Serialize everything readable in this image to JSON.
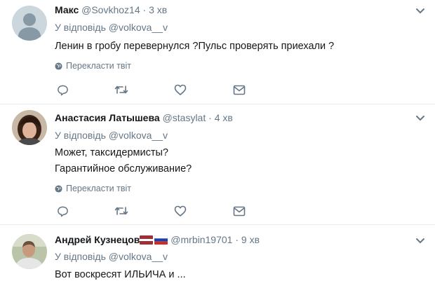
{
  "colors": {
    "text": "#14171a",
    "secondary": "#657786",
    "divider": "#e6ecf0"
  },
  "tweets": [
    {
      "name": "Макс",
      "handle": "@Sovkhoz14",
      "time": "3 хв",
      "reply_prefix": "У відповідь",
      "reply_to": "@volkova__v",
      "lines": [
        "Ленин в гробу перевернулся ?Пульс проверять приехали ?"
      ],
      "translate": "Перекласти твіт",
      "avatar": "default-avatar-icon"
    },
    {
      "name": "Анастасия Латышева",
      "handle": "@stasylat",
      "time": "4 хв",
      "reply_prefix": "У відповідь",
      "reply_to": "@volkova__v",
      "lines": [
        "Может, таксидермисты?",
        "Гарантийное обслуживание?"
      ],
      "translate": "Перекласти твіт",
      "avatar": "user-photo-avatar"
    },
    {
      "name": "Андрей Кузнецов",
      "handle": "@mrbin19701",
      "time": "9 хв",
      "reply_prefix": "У відповідь",
      "reply_to": "@volkova__v",
      "lines": [
        "Вот воскресят ИЛЬИЧА и ..."
      ],
      "avatar": "user-photo-avatar",
      "flag_icons": [
        "latvia-flag-icon",
        "russia-flag-icon"
      ]
    }
  ],
  "dot": "·"
}
